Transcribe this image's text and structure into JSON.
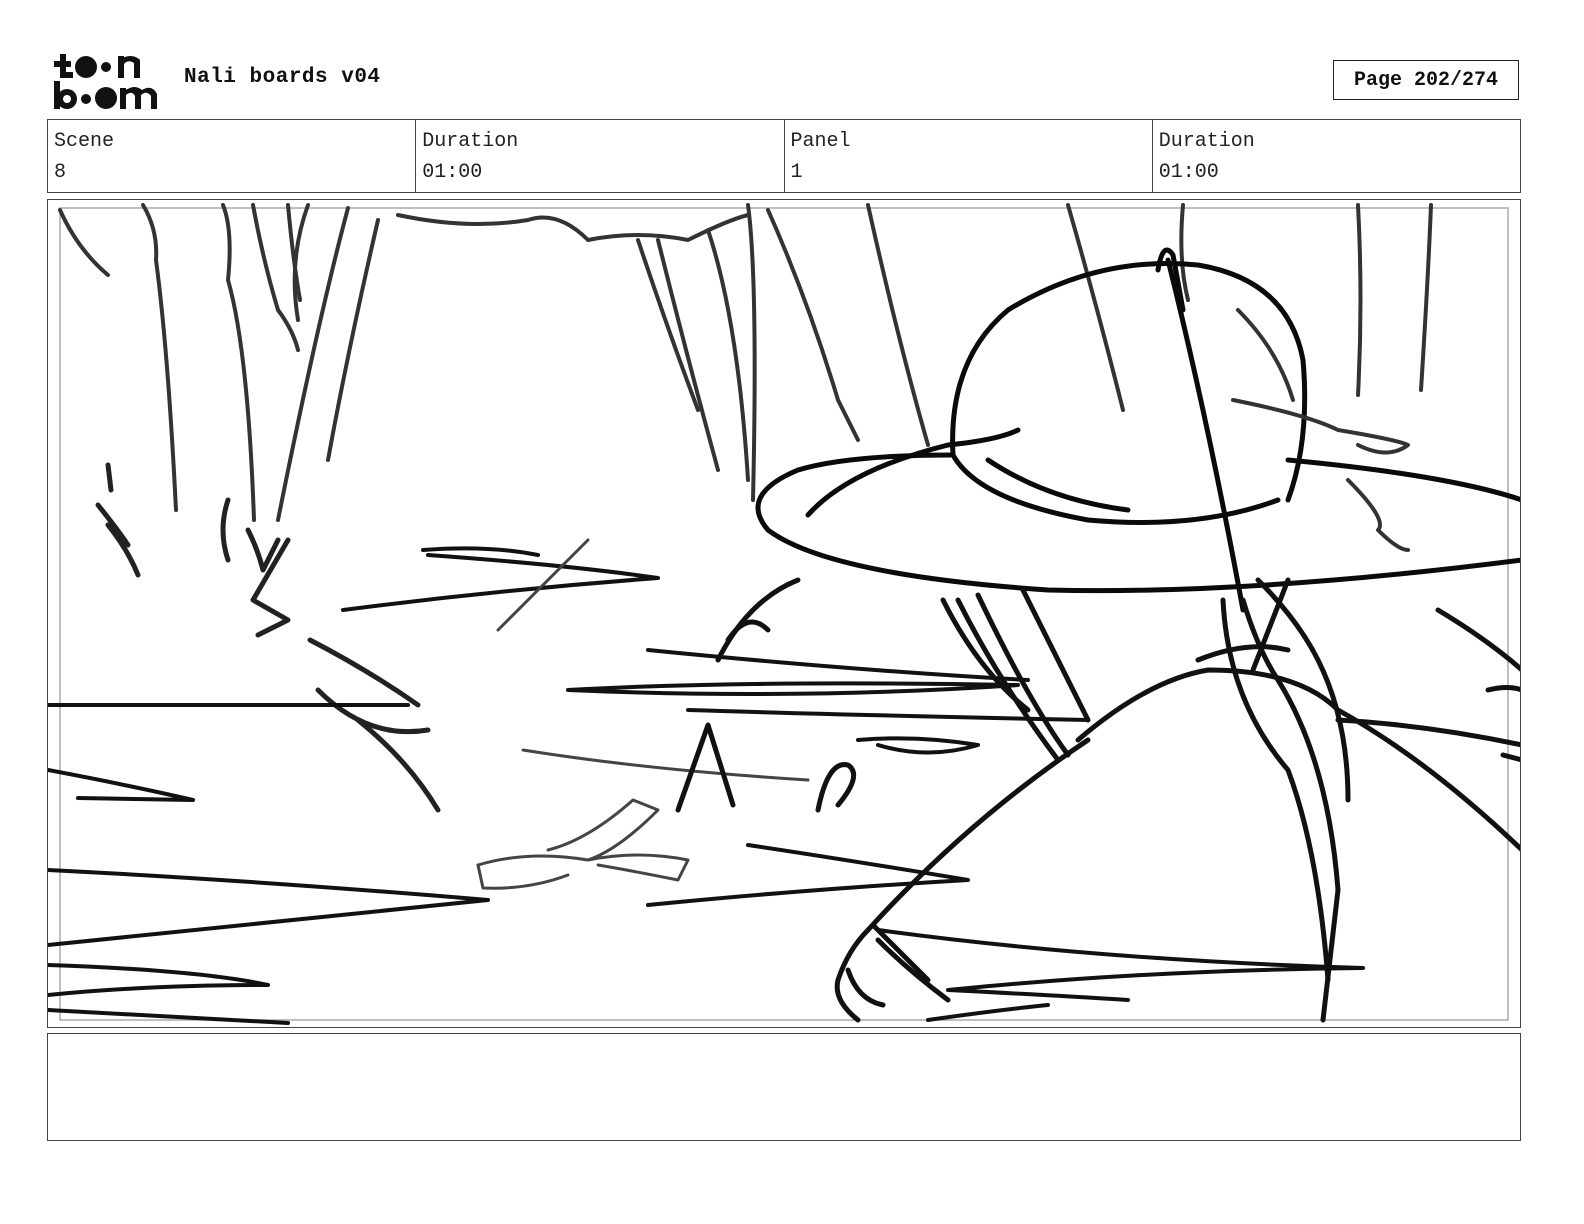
{
  "header": {
    "logo_text": "toon boom",
    "title": "Nali boards v04",
    "page": "Page 202/274"
  },
  "info": [
    {
      "label": "Scene",
      "value": "8"
    },
    {
      "label": "Duration",
      "value": "01:00"
    },
    {
      "label": "Panel",
      "value": "1"
    },
    {
      "label": "Duration",
      "value": "01:00"
    }
  ],
  "notes": ""
}
